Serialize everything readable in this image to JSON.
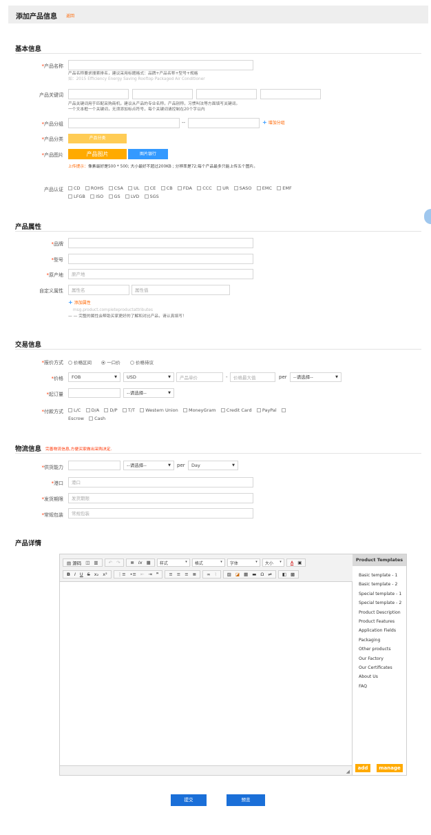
{
  "header": {
    "title": "添加产品信息",
    "back": "返回"
  },
  "basic": {
    "section_title": "基本信息",
    "name_label": "产品名称",
    "name_hint1": "产品名称要求搜索排名，建议采用标题格式：品牌+产品名称+型号+规格",
    "name_hint2": "如：2015 Efficiency Energy Saving Rooftop Packaged Air Conditioner",
    "keyword_label": "产品关键词",
    "keyword_hint1": "产品关键词用于匹配采购商机，建议从产品的专业名称，产品别称，习惯叫法等方面填写关键词。",
    "keyword_hint2": "一个文本框一个关键词，无须添加标点符号，每个关键词请控制在20个字以内",
    "group_label": "产品分组",
    "group_sep": "--",
    "add_group": "增加分组",
    "category_label": "产品分类",
    "category_btn": "产品分类",
    "image_label": "产品图片",
    "image_btn": "产品图片",
    "gallery_btn": "图片银行",
    "upload_tip_prefix": "上传提示：",
    "upload_tip": "像素最好是500 * 500; 大小最好不超过200KB ; 分辨率是72;每个产品最多只能上传五个图片。",
    "cert_label": "产品认证",
    "certs_row1": [
      "CD",
      "ROHS",
      "CSA",
      "UL",
      "CE",
      "CB",
      "FDA",
      "CCC",
      "UR",
      "SASO",
      "EMC",
      "EMF"
    ],
    "certs_row2": [
      "LFGB",
      "ISO",
      "GS",
      "LVD",
      "SGS"
    ]
  },
  "attrs": {
    "section_title": "产品属性",
    "brand_label": "品牌",
    "model_label": "型号",
    "origin_label": "原产地",
    "origin_placeholder": "原产地",
    "custom_label": "自定义属性",
    "attr_name_placeholder": "属性名",
    "attr_value_placeholder": "属性值",
    "add_attr": "添加属性",
    "attr_hint1": "msg.product.completeproductattributes",
    "attr_hint2": "— — 完整的属性会帮助买家更好的了解和对比产品，请认真填写！"
  },
  "trade": {
    "section_title": "交易信息",
    "quote_label": "报价方式",
    "quote_options": [
      "价格区间",
      "一口价",
      "价格待议"
    ],
    "quote_selected": 1,
    "price_label": "价格",
    "price_term": "FOB",
    "currency": "USD",
    "unit_price_placeholder": "产品单价",
    "price_dash": "-",
    "max_price_placeholder": "价格最大值",
    "per": "per",
    "unit_select": "--请选择--",
    "moq_label": "起订量",
    "moq_unit_select": "--请选择--",
    "payment_label": "付款方式",
    "payments_row1": [
      "L/C",
      "D/A",
      "D/P",
      "T/T",
      "Western Union",
      "MoneyGram",
      "Credit Card",
      "PayPal"
    ],
    "payments_row2": [
      "Escrow",
      "Cash"
    ]
  },
  "logistics": {
    "section_title": "物流信息",
    "section_note": "完善物流信息,方便买家做出采购决定.",
    "supply_label": "供货能力",
    "supply_unit_select": "--请选择--",
    "per": "per",
    "period_select": "Day",
    "port_label": "港口",
    "port_placeholder": "港口",
    "delivery_label": "发货期限",
    "delivery_placeholder": "发货期限",
    "packing_label": "常规包装",
    "packing_placeholder": "常规包装"
  },
  "details": {
    "section_title": "产品详情",
    "toolbar": {
      "source": "源码",
      "style_drop": "样式",
      "format_drop": "格式",
      "font_drop": "字体",
      "size_drop": "大小"
    },
    "templates_title": "Product Templates",
    "templates": [
      "Basic template - 1",
      "Basic template - 2",
      "Special template - 1",
      "Special template - 2",
      "Product Description",
      "Product Features",
      "Application Fields",
      "Packaging",
      "Other products",
      "Our Factory",
      "Our Certificates",
      "About Us",
      "FAQ"
    ],
    "add_btn": "add",
    "manage_btn": "manage"
  },
  "actions": {
    "submit": "提交",
    "preview": "预览"
  },
  "colors": {
    "accent_orange": "#ffaa00",
    "required_red": "#ff3300",
    "primary_blue": "#1a6fd8",
    "link_blue": "#3399ff"
  }
}
